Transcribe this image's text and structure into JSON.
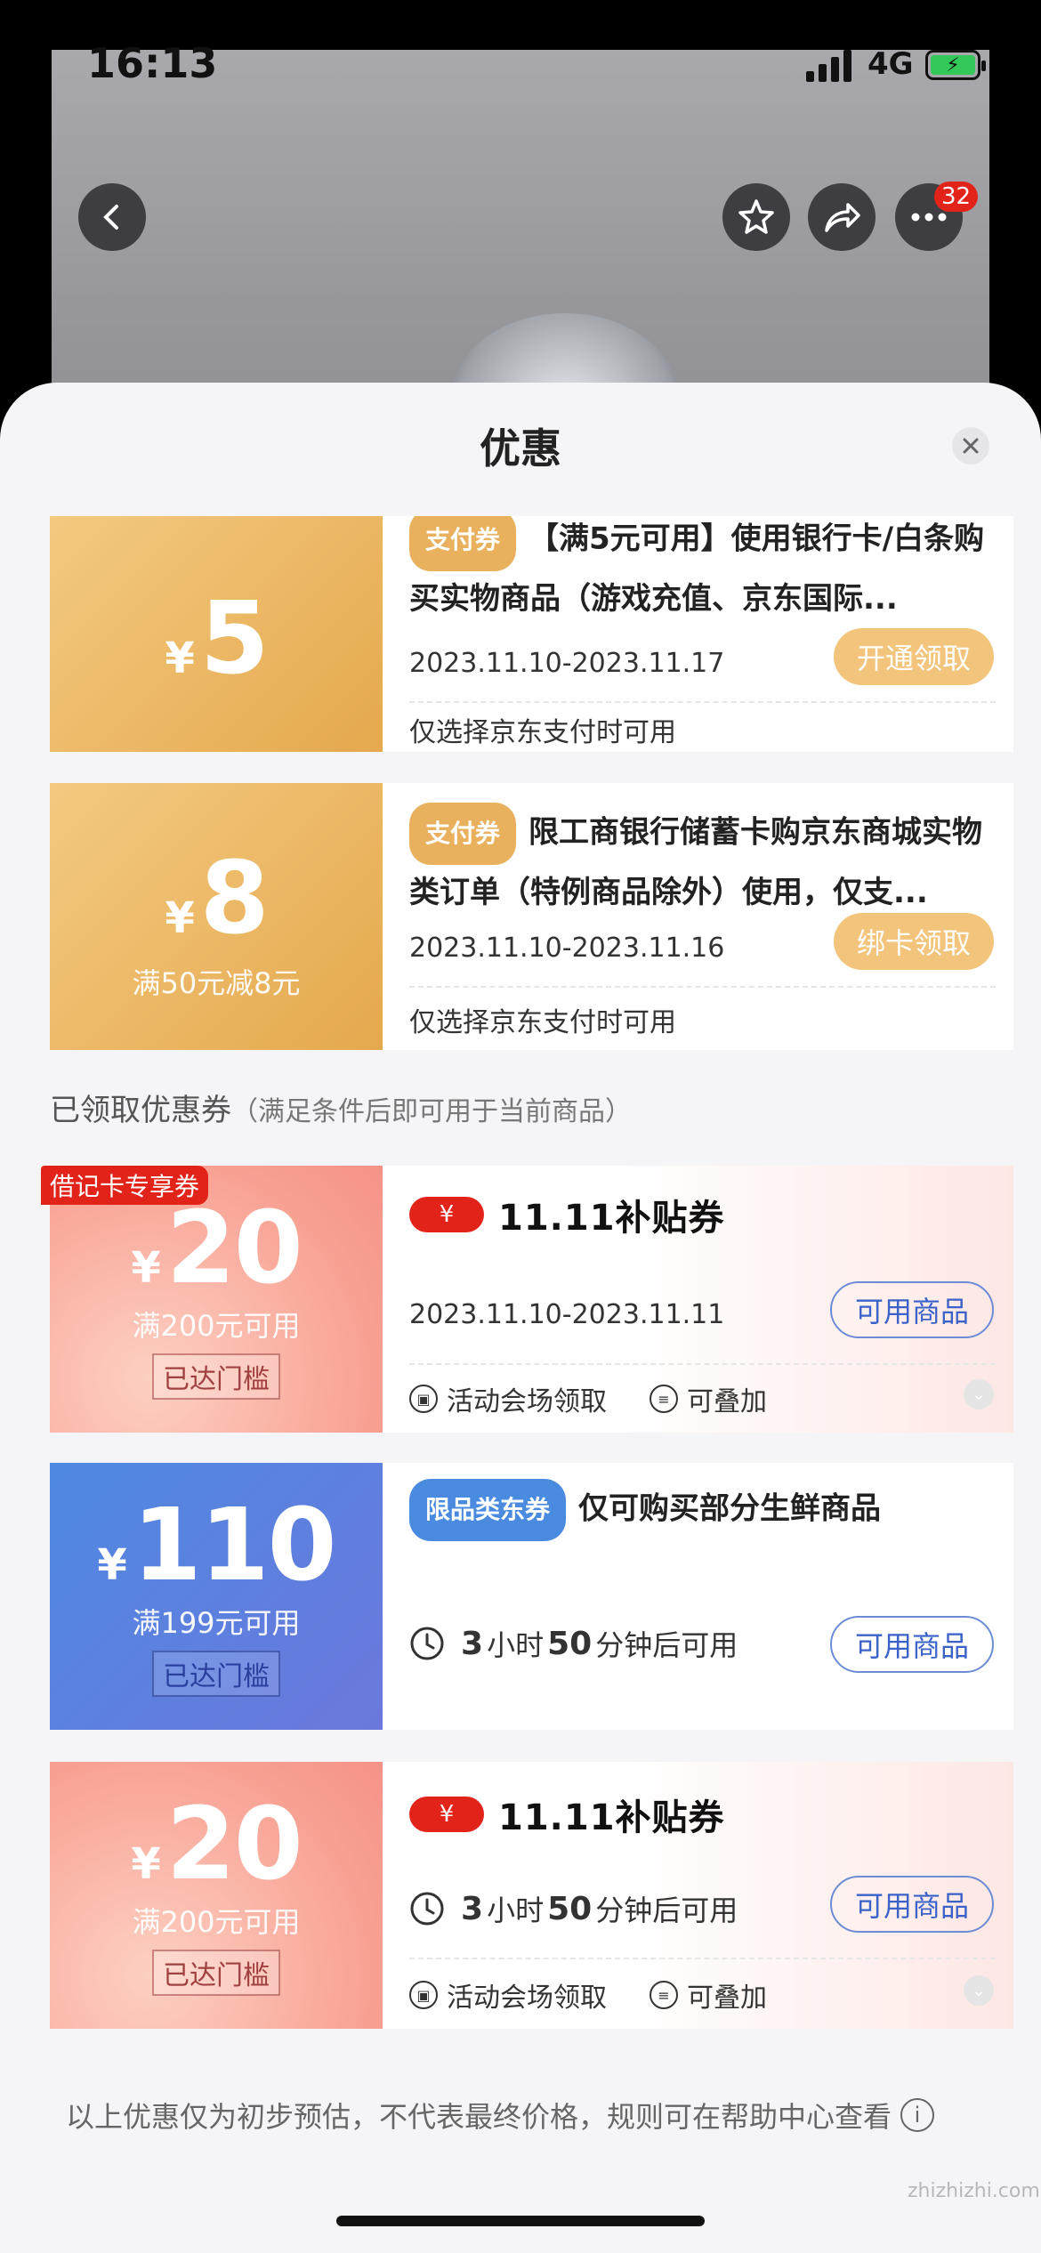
{
  "status_bar": {
    "time": "16:13",
    "network": "4G"
  },
  "top_badge": "32",
  "sheet_title": "优惠",
  "coupons_top": [
    {
      "yen": "¥",
      "amount": "5",
      "tag": "支付券",
      "title": "【满5元可用】使用银行卡/白条购买实物商品（游戏充值、京东国际...",
      "date": "2023.11.10-2023.11.17",
      "note": "仅选择京东支付时可用",
      "action": "开通领取"
    },
    {
      "yen": "¥",
      "amount": "8",
      "condition": "满50元减8元",
      "corner_label": "借记卡专享券",
      "tag": "支付券",
      "title": "限工商银行储蓄卡购京东商城实物类订单（特例商品除外）使用，仅支...",
      "date": "2023.11.10-2023.11.16",
      "note": "仅选择京东支付时可用",
      "action": "绑卡领取"
    }
  ],
  "section": {
    "label": "已领取优惠券",
    "sub": "（满足条件后即可用于当前商品）"
  },
  "coupons_claimed": [
    {
      "yen": "¥",
      "amount": "20",
      "condition": "满200元可用",
      "reached": "已达门槛",
      "badge_yen": "¥",
      "badge_title": "11.11补贴券",
      "date": "2023.11.10-2023.11.11",
      "action": "可用商品",
      "info1": "活动会场领取",
      "info2": "可叠加"
    },
    {
      "yen": "¥",
      "amount": "110",
      "condition": "满199元可用",
      "reached": "已达门槛",
      "tag": "限品类东券",
      "title": "仅可购买部分生鲜商品",
      "cd_h": "3",
      "cd_h_unit": "小时",
      "cd_m": "50",
      "cd_m_unit": "分钟后可用",
      "action": "可用商品"
    },
    {
      "yen": "¥",
      "amount": "20",
      "condition": "满200元可用",
      "reached": "已达门槛",
      "badge_yen": "¥",
      "badge_title": "11.11补贴券",
      "cd_h": "3",
      "cd_h_unit": "小时",
      "cd_m": "50",
      "cd_m_unit": "分钟后可用",
      "action": "可用商品",
      "info1": "活动会场领取",
      "info2": "可叠加"
    }
  ],
  "footer_note": "以上优惠仅为初步预估，不代表最终价格，规则可在帮助中心查看",
  "watermark": "zhizhizhi.com",
  "colors": {
    "gold": "#f3c57c",
    "red": "#e2231a",
    "blue": "#6d8cd6"
  }
}
